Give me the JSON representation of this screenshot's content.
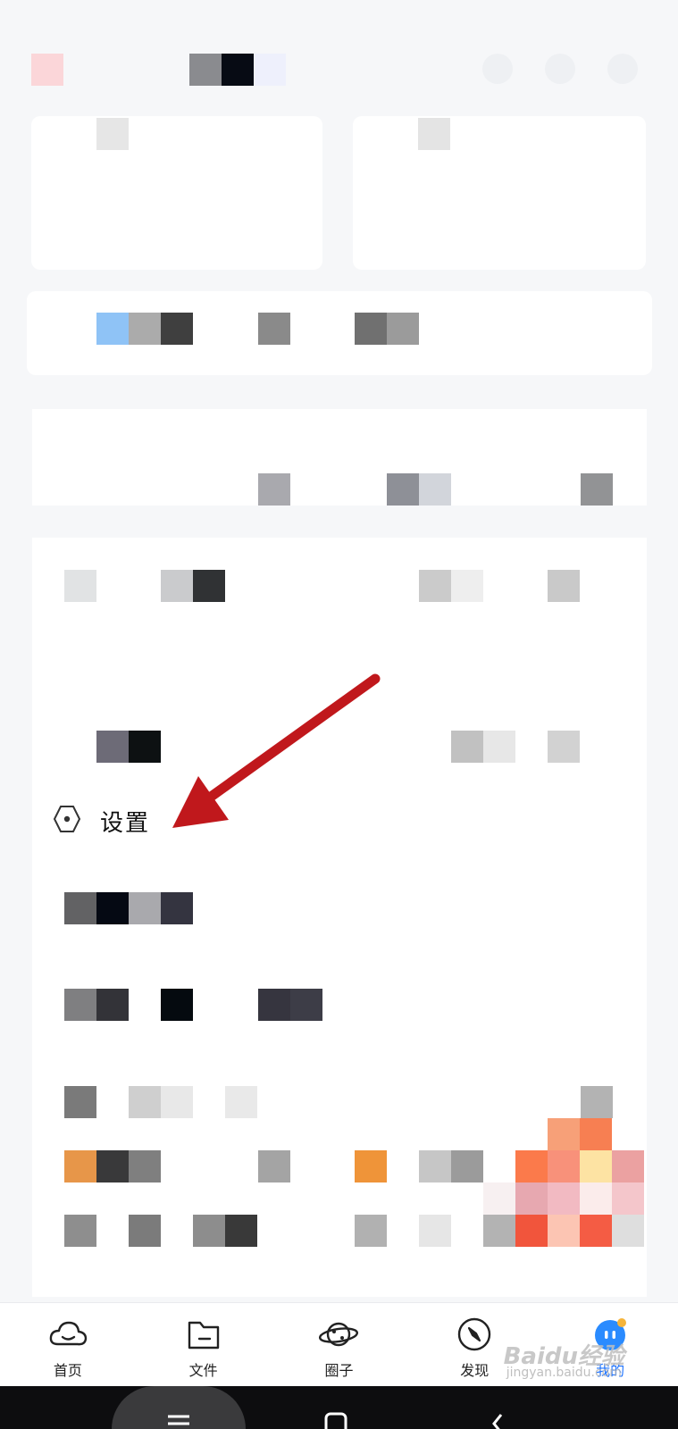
{
  "settings": {
    "label": "设置",
    "icon": "hexagon-settings-icon"
  },
  "bottom_nav": {
    "items": [
      {
        "label": "首页",
        "icon": "cloud-home-icon",
        "active": false
      },
      {
        "label": "文件",
        "icon": "folder-icon",
        "active": false
      },
      {
        "label": "圈子",
        "icon": "planet-icon",
        "active": false
      },
      {
        "label": "发现",
        "icon": "compass-icon",
        "active": false
      },
      {
        "label": "我的",
        "icon": "avatar-mascot-icon",
        "active": true
      }
    ]
  },
  "watermark": {
    "line1": "Baidu经验",
    "line2": "jingyan.baidu.com"
  },
  "colors": {
    "accent": "#1f74ff",
    "arrow": "#c0181c"
  }
}
